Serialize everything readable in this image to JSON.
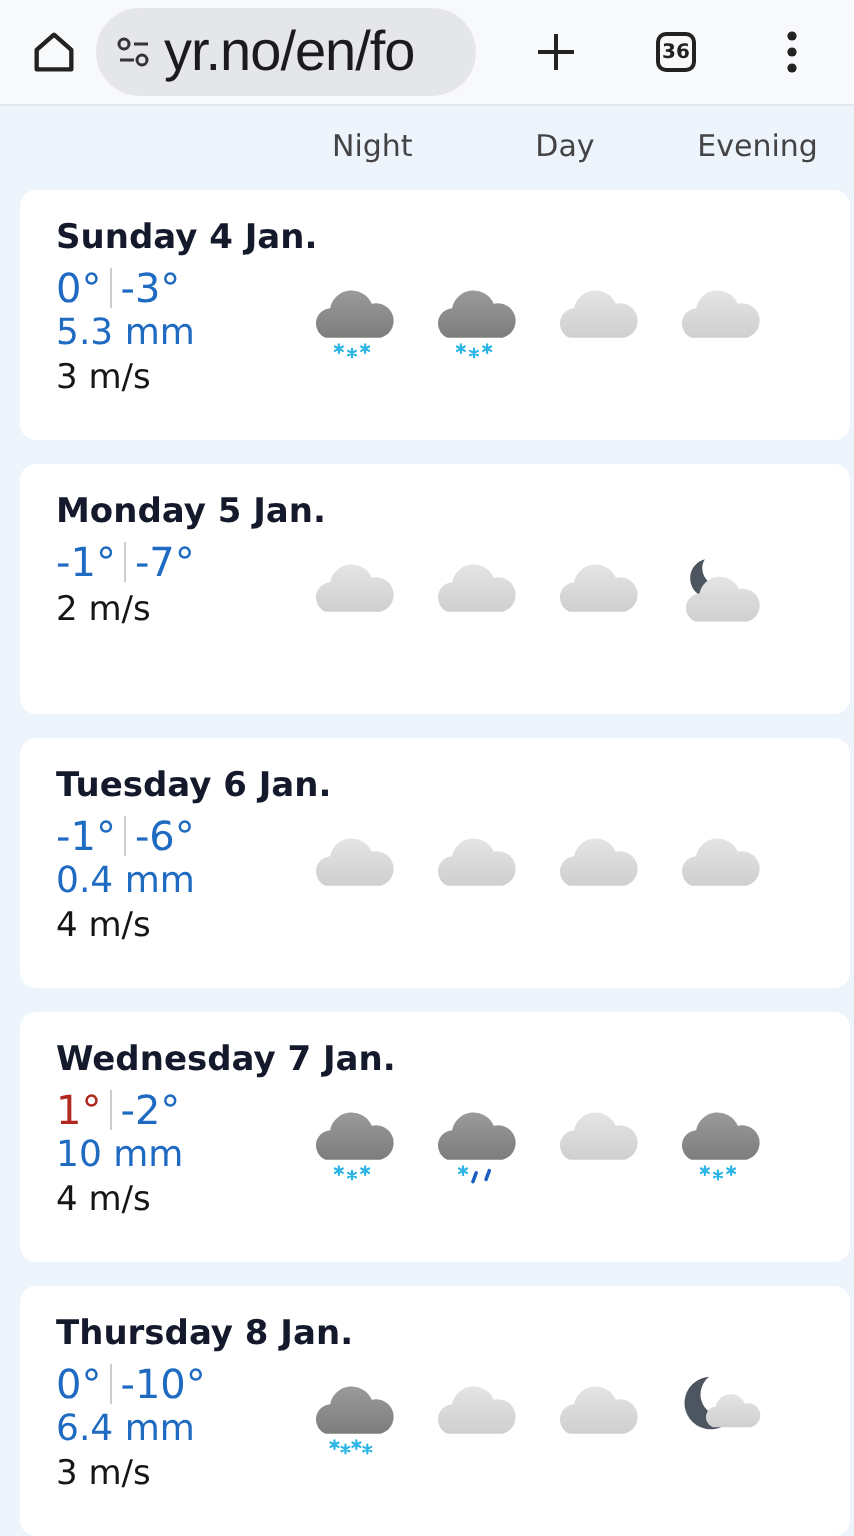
{
  "browser": {
    "url": "yr.no/en/fo",
    "tab_count": "36"
  },
  "columns": [
    "Night",
    "Day",
    "Evening"
  ],
  "days": [
    {
      "title": "Sunday 4 Jan.",
      "high": {
        "value": "0°",
        "warm": false
      },
      "low": {
        "value": "-3°",
        "warm": false
      },
      "precipitation": "5.3 mm",
      "wind": "3 m/s",
      "icons": [
        {
          "kind": "snow"
        },
        {
          "kind": "snow"
        },
        {
          "kind": "cloudy"
        },
        {
          "kind": "cloudy"
        }
      ]
    },
    {
      "title": "Monday 5 Jan.",
      "high": {
        "value": "-1°",
        "warm": false
      },
      "low": {
        "value": "-7°",
        "warm": false
      },
      "wind": "2 m/s",
      "icons": [
        {
          "kind": "cloudy"
        },
        {
          "kind": "cloudy"
        },
        {
          "kind": "cloudy"
        },
        {
          "kind": "cloudy-night"
        }
      ]
    },
    {
      "title": "Tuesday 6 Jan.",
      "high": {
        "value": "-1°",
        "warm": false
      },
      "low": {
        "value": "-6°",
        "warm": false
      },
      "precipitation": "0.4 mm",
      "wind": "4 m/s",
      "icons": [
        {
          "kind": "cloudy"
        },
        {
          "kind": "cloudy"
        },
        {
          "kind": "cloudy"
        },
        {
          "kind": "cloudy"
        }
      ]
    },
    {
      "title": "Wednesday 7 Jan.",
      "high": {
        "value": "1°",
        "warm": true
      },
      "low": {
        "value": "-2°",
        "warm": false
      },
      "precipitation": "10 mm",
      "wind": "4 m/s",
      "icons": [
        {
          "kind": "snow"
        },
        {
          "kind": "sleet"
        },
        {
          "kind": "cloudy"
        },
        {
          "kind": "snow"
        }
      ]
    },
    {
      "title": "Thursday 8 Jan.",
      "high": {
        "value": "0°",
        "warm": false
      },
      "low": {
        "value": "-10°",
        "warm": false
      },
      "precipitation": "6.4 mm",
      "wind": "3 m/s",
      "icons": [
        {
          "kind": "heavy-snow"
        },
        {
          "kind": "cloudy"
        },
        {
          "kind": "cloudy"
        },
        {
          "kind": "fair-night"
        }
      ]
    }
  ]
}
